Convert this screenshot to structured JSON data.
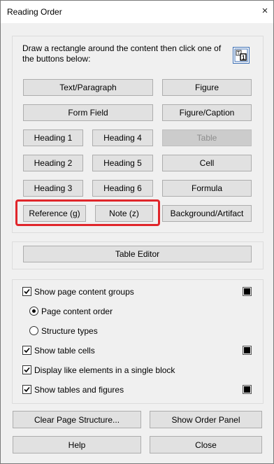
{
  "window": {
    "title": "Reading Order",
    "close_symbol": "×"
  },
  "tagging": {
    "instructions": "Draw a rectangle around the content then click one of the buttons below:",
    "buttons": {
      "text_paragraph": "Text/Paragraph",
      "figure": "Figure",
      "form_field": "Form Field",
      "figure_caption": "Figure/Caption",
      "heading1": "Heading 1",
      "heading4": "Heading 4",
      "table": "Table",
      "heading2": "Heading 2",
      "heading5": "Heading 5",
      "cell": "Cell",
      "heading3": "Heading 3",
      "heading6": "Heading 6",
      "formula": "Formula",
      "reference": "Reference (g)",
      "note": "Note (z)",
      "background_artifact": "Background/Artifact"
    }
  },
  "table_editor": {
    "label": "Table Editor"
  },
  "options": {
    "show_page_content_groups": {
      "label": "Show page content groups",
      "checked": true,
      "color": "#000000"
    },
    "page_content_order": {
      "label": "Page content order",
      "selected": true
    },
    "structure_types": {
      "label": "Structure types",
      "selected": false
    },
    "show_table_cells": {
      "label": "Show table cells",
      "checked": true,
      "color": "#000000"
    },
    "display_like_elements": {
      "label": "Display like elements in a single block",
      "checked": true
    },
    "show_tables_and_figures": {
      "label": "Show tables and figures",
      "checked": true,
      "color": "#000000"
    }
  },
  "footer": {
    "clear_page_structure": "Clear Page Structure...",
    "show_order_panel": "Show Order Panel",
    "help": "Help",
    "close": "Close"
  },
  "colors": {
    "highlight": "#e0262b",
    "icon_accent": "#3c6fb4"
  }
}
